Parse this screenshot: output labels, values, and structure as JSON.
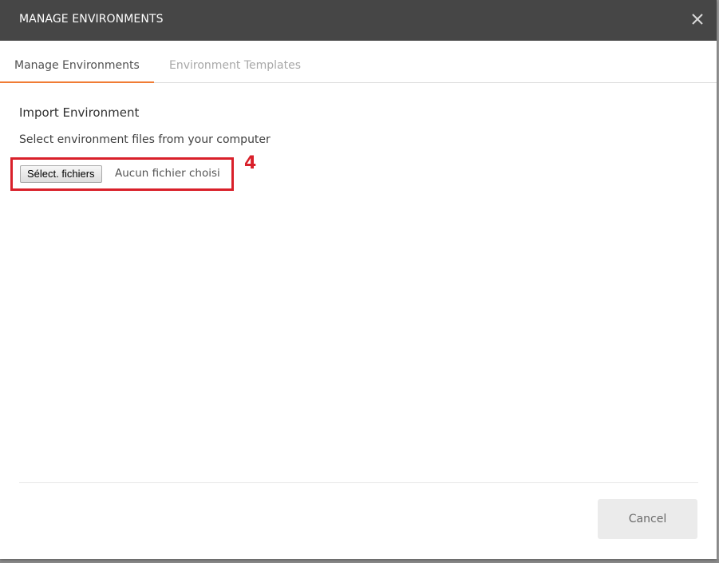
{
  "modal": {
    "title": "MANAGE ENVIRONMENTS",
    "close_icon": "close-icon"
  },
  "tabs": [
    {
      "label": "Manage Environments",
      "active": true
    },
    {
      "label": "Environment Templates",
      "active": false
    }
  ],
  "import": {
    "title": "Import Environment",
    "description": "Select environment files from your computer",
    "file_button_label": "Sélect. fichiers",
    "file_status": "Aucun fichier choisi"
  },
  "annotation": {
    "number": "4",
    "color": "#d9202a"
  },
  "footer": {
    "cancel_label": "Cancel"
  },
  "colors": {
    "header_bg": "#464646",
    "active_tab_accent": "#f07c34"
  }
}
